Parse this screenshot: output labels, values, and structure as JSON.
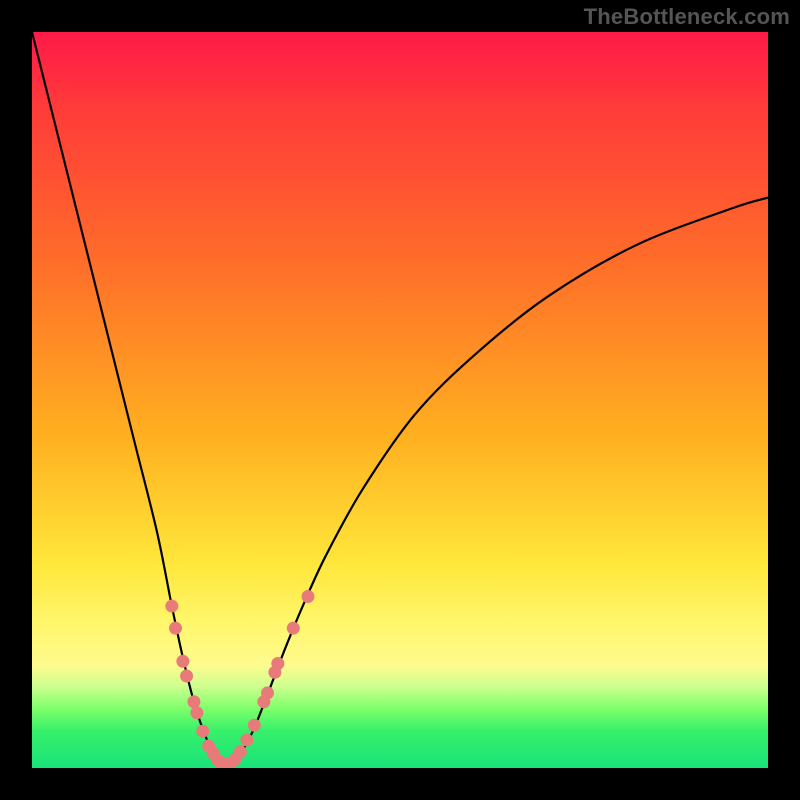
{
  "watermark": "TheBottleneck.com",
  "colors": {
    "frame": "#000000",
    "dot": "#e97a7a",
    "curve": "#000000",
    "gradient_top": "#ff1a48",
    "gradient_bottom": "#19e37a"
  },
  "chart_data": {
    "type": "line",
    "title": "",
    "xlabel": "",
    "ylabel": "",
    "xlim": [
      0,
      100
    ],
    "ylim": [
      0,
      100
    ],
    "note": "No axis ticks or labels are visible in the image; x and y are normalized 0–100 to the plot area. The curve is a V-shaped bottleneck curve with minimum near x≈26. Dots are highlighted sample points on the curve.",
    "series": [
      {
        "name": "bottleneck-curve",
        "x": [
          0,
          2,
          5,
          8,
          11,
          14,
          17,
          19,
          20.5,
          22,
          23.5,
          25,
          26.5,
          28,
          30,
          32,
          34.5,
          37,
          40,
          45,
          52,
          60,
          70,
          82,
          95,
          100
        ],
        "y": [
          100,
          92,
          80,
          68,
          56,
          44,
          32,
          22,
          15,
          9,
          4.5,
          1.5,
          0.5,
          1.5,
          5,
          10,
          16.5,
          22.5,
          29,
          38,
          48,
          56,
          64,
          71,
          76,
          77.5
        ]
      }
    ],
    "dots": [
      {
        "x": 19.0,
        "y": 22.0
      },
      {
        "x": 19.5,
        "y": 19.0
      },
      {
        "x": 20.5,
        "y": 14.5
      },
      {
        "x": 21.0,
        "y": 12.5
      },
      {
        "x": 22.0,
        "y": 9.0
      },
      {
        "x": 22.4,
        "y": 7.5
      },
      {
        "x": 23.2,
        "y": 5.0
      },
      {
        "x": 24.0,
        "y": 3.0
      },
      {
        "x": 24.6,
        "y": 2.0
      },
      {
        "x": 25.3,
        "y": 1.0
      },
      {
        "x": 26.0,
        "y": 0.6
      },
      {
        "x": 26.8,
        "y": 0.6
      },
      {
        "x": 27.6,
        "y": 1.2
      },
      {
        "x": 28.3,
        "y": 2.2
      },
      {
        "x": 29.2,
        "y": 3.8
      },
      {
        "x": 30.2,
        "y": 5.8
      },
      {
        "x": 31.5,
        "y": 9.0
      },
      {
        "x": 32.0,
        "y": 10.2
      },
      {
        "x": 33.0,
        "y": 13.0
      },
      {
        "x": 33.4,
        "y": 14.2
      },
      {
        "x": 35.5,
        "y": 19.0
      },
      {
        "x": 37.5,
        "y": 23.3
      }
    ]
  }
}
